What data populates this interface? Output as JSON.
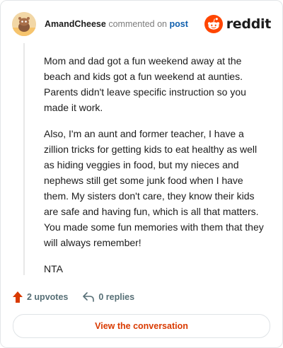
{
  "header": {
    "username": "AmandCheese",
    "action_text": "commented on",
    "post_link": "post",
    "brand": "reddit"
  },
  "comment": {
    "paragraphs": [
      "Mom and dad got a fun weekend away at the beach and kids got a fun weekend at aunties. Parents didn't leave specific instruction so you made it work.",
      "Also, I'm an aunt and former teacher, I have a zillion tricks for getting kids to eat healthy as well as hiding veggies in food, but my nieces and nephews still get some junk food when I have them. My sisters don't care, they know their kids are safe and having fun, which is all that matters. You made some fun memories with them that they will always remember!",
      "NTA"
    ]
  },
  "actions": {
    "upvotes_label": "2 upvotes",
    "replies_label": "0 replies"
  },
  "footer": {
    "cta_label": "View the conversation"
  },
  "colors": {
    "brand_orange": "#ff4500",
    "upvote": "#d93a00",
    "link": "#0f5fae"
  },
  "icons": {
    "avatar": "snoo-avatar",
    "brand": "reddit-alien-icon",
    "upvote": "upvote-arrow-icon",
    "reply": "reply-arrow-icon"
  }
}
